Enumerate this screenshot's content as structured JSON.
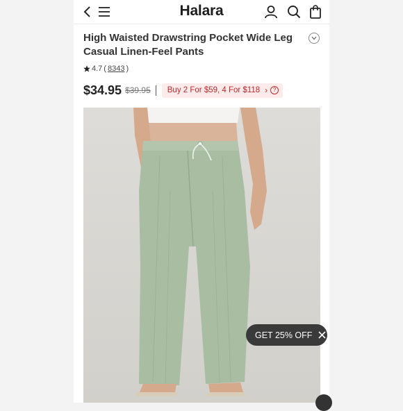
{
  "header": {
    "logo": "Halara",
    "icons": [
      "back-icon",
      "menu-icon",
      "account-icon",
      "search-icon",
      "bag-icon"
    ]
  },
  "product": {
    "title": "High Waisted Drawstring Pocket Wide Leg Casual Linen-Feel Pants",
    "rating": "4.7",
    "review_count": "8343",
    "price": "$34.95",
    "original_price": "$39.95",
    "promo": "Buy 2 For $59, 4 For $118"
  },
  "cta": {
    "label": "GET 25% OFF"
  },
  "colors": {
    "promo_text": "#c0282c",
    "promo_bg": "#fcebea",
    "pants": "#a9bda3",
    "cta_bg": "#3a3a3a"
  }
}
